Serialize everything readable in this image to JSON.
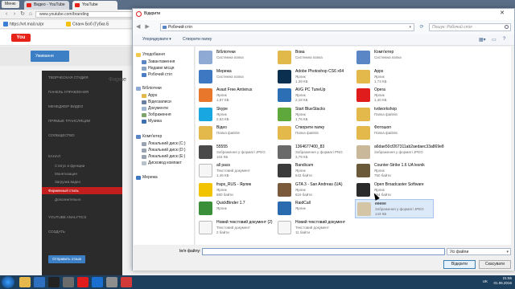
{
  "browser": {
    "menu_label": "Меню",
    "tabs": [
      {
        "label": "Видео - YouTube",
        "color": "#e62117"
      },
      {
        "label": "YouTube",
        "color": "#e62117"
      }
    ],
    "url": "www.youtube.com/branding",
    "bookmarks": [
      {
        "label": "https://vrl.mail.ru/pr",
        "color": "#3a7fd5"
      },
      {
        "label": "Спанч Боб (Губка Б",
        "color": "#f4c20d"
      }
    ]
  },
  "youtube": {
    "logo": "You",
    "subscribe_label": "Уживання",
    "studio_items": [
      "ТВОРЧЕСКАЯ СТУДИЯ",
      "ПАНЕЛЬ УПРАВЛЕНИЯ",
      "МЕНЕДЖЕР ВИДЕО",
      "ПРЯМЫЕ ТРАНСЛЯЦИИ",
      "СООБЩЕСТВО",
      "КАНАЛ",
      "Статус и функции",
      "Монетизация",
      "Загрузка видео",
      "Фирменный стиль",
      "Дополнительно",
      "YOUTUBE ANALYTICS",
      "СОЗДАТЬ"
    ],
    "active_item": "Фирменный стиль",
    "right_heading": "Фирме",
    "save_label": "Отправить отзыв"
  },
  "dialog": {
    "title": "Відкрити",
    "path": "Робочий стіл",
    "search_placeholder": "Пошук: Робочий стіл",
    "toolbar": {
      "organize": "Упорядкувати ▾",
      "new_folder": "Створити папку"
    },
    "nav": {
      "favorites_header": "Уподобання",
      "favorites": [
        "Завантаження",
        "Недавні місця",
        "Робочий стіл"
      ],
      "libraries_header": "Бібліотеки",
      "libraries": [
        "Apps",
        "Відеозаписи",
        "Документи",
        "Зображення",
        "Музика"
      ],
      "computer_header": "Комп'ютер",
      "drives": [
        "Локальний диск (C:)",
        "Локальний диск (D:)",
        "Локальний диск (E:)",
        "Дисковод компакт"
      ],
      "network": "Мережа"
    },
    "files": [
      {
        "name": "Бібліотеки",
        "type": "Системна папка",
        "size": "",
        "icon": "libraries-icon",
        "color": "#8da9d4"
      },
      {
        "name": "Вова",
        "type": "Системна папка",
        "size": "",
        "icon": "user-folder-icon",
        "color": "#e0b94a"
      },
      {
        "name": "Комп'ютер",
        "type": "Системна папка",
        "size": "",
        "icon": "computer-icon",
        "color": "#5b86c5"
      },
      {
        "name": "",
        "type": "",
        "size": "",
        "icon": "blank-icon",
        "color": "#ffffff"
      },
      {
        "name": "Мережа",
        "type": "Системна папка",
        "size": "",
        "icon": "network-icon",
        "color": "#3f78c2"
      },
      {
        "name": "Adobe Photoshop CS6 x64",
        "type": "Ярлик",
        "size": "1,39 КБ",
        "icon": "photoshop-icon",
        "color": "#0b2f4e"
      },
      {
        "name": "Apps",
        "type": "Ярлик",
        "size": "1,73 КБ",
        "icon": "apps-folder-icon",
        "color": "#e3b94c"
      },
      {
        "name": "",
        "type": "",
        "size": "",
        "icon": "blank-icon",
        "color": "#ffffff"
      },
      {
        "name": "Avast Free Antivirus",
        "type": "Ярлик",
        "size": "1,87 КБ",
        "icon": "avast-icon",
        "color": "#e8762b"
      },
      {
        "name": "AVG PC TuneUp",
        "type": "Ярлик",
        "size": "2,18 КБ",
        "icon": "tuneup-icon",
        "color": "#2c6fb5"
      },
      {
        "name": "Opera",
        "type": "Ярлик",
        "size": "1,40 КБ",
        "icon": "opera-icon",
        "color": "#e01c1c"
      },
      {
        "name": "",
        "type": "",
        "size": "",
        "icon": "blank-icon",
        "color": "#ffffff"
      },
      {
        "name": "Skype",
        "type": "Ярлик",
        "size": "2,63 КБ",
        "icon": "skype-icon",
        "color": "#18a7e0"
      },
      {
        "name": "Start BlueStacks",
        "type": "Ярлик",
        "size": "1,76 КБ",
        "icon": "bluestacks-icon",
        "color": "#5fa83b"
      },
      {
        "name": "tvdworkshop",
        "type": "Папка файлів",
        "size": "",
        "icon": "folder-icon",
        "color": "#e3b94c"
      },
      {
        "name": "",
        "type": "",
        "size": "",
        "icon": "blank-icon",
        "color": "#ffffff"
      },
      {
        "name": "Відео",
        "type": "Папка файлів",
        "size": "",
        "icon": "video-folder-icon",
        "color": "#e3b94c"
      },
      {
        "name": "Створити папку",
        "type": "Папка файлів",
        "size": "",
        "icon": "folder-icon",
        "color": "#e3b94c"
      },
      {
        "name": "Фотошоп",
        "type": "Папка файлів",
        "size": "",
        "icon": "folder-icon",
        "color": "#e3b94c"
      },
      {
        "name": "",
        "type": "",
        "size": "",
        "icon": "blank-icon",
        "color": "#ffffff"
      },
      {
        "name": "55555",
        "type": "Зображення у форматі JPEG",
        "size": "104 КБ",
        "icon": "image-thumb-icon",
        "color": "#4a4a4a"
      },
      {
        "name": "1364677400_83",
        "type": "Зображення у форматі PNG",
        "size": "3,79 КБ",
        "icon": "image-thumb-icon",
        "color": "#6a6a6a"
      },
      {
        "name": "a6dae50cf267311ab2aedaec33a869e8",
        "type": "Зображення у форматі JPEG",
        "size": "",
        "icon": "image-thumb-icon",
        "color": "#c9b89a"
      },
      {
        "name": "",
        "type": "",
        "size": "",
        "icon": "blank-icon",
        "color": "#ffffff"
      },
      {
        "name": "all pass",
        "type": "Текстовий документ",
        "size": "1,46 КБ",
        "icon": "text-doc-icon",
        "color": "#f6f6f6"
      },
      {
        "name": "Bandicam",
        "type": "Ярлик",
        "size": "642 байти",
        "icon": "bandicam-icon",
        "color": "#3b3b3b"
      },
      {
        "name": "Counter-Strike 1.6 UA lesnik",
        "type": "Ярлик",
        "size": "750 байти",
        "icon": "cs-icon",
        "color": "#6b5a3a"
      },
      {
        "name": "",
        "type": "",
        "size": "",
        "icon": "blank-icon",
        "color": "#ffffff"
      },
      {
        "name": "fraps_RUS - Ярлик",
        "type": "Ярлик",
        "size": "680 байти",
        "icon": "fraps-icon",
        "color": "#f2c300"
      },
      {
        "name": "GTA 3 - San Andreas (UA)",
        "type": "Ярлик",
        "size": "616 байти",
        "icon": "gta-icon",
        "color": "#7a5a3a"
      },
      {
        "name": "Open Broadcaster Software",
        "type": "Ярлик",
        "size": "664 байти",
        "icon": "obs-icon",
        "color": "#2b2b2b"
      },
      {
        "name": "",
        "type": "",
        "size": "",
        "icon": "blank-icon",
        "color": "#ffffff"
      },
      {
        "name": "QuickBinder 1.7",
        "type": "Ярлик",
        "size": "",
        "icon": "quickbinder-icon",
        "color": "#3a8f3a"
      },
      {
        "name": "RaidCall",
        "type": "Ярлик",
        "size": "",
        "icon": "raidcall-icon",
        "color": "#2a6bb0"
      },
      {
        "name": "eeeee",
        "type": "Зображення у форматі JPEG",
        "size": "143 КБ",
        "icon": "image-thumb-icon",
        "color": "#d3c5a6"
      },
      {
        "name": "",
        "type": "",
        "size": "",
        "icon": "blank-icon",
        "color": "#ffffff"
      },
      {
        "name": "Новий текстовий документ (2)",
        "type": "Текстовий документ",
        "size": "2 байти",
        "icon": "text-doc-icon",
        "color": "#f6f6f6"
      },
      {
        "name": "Новий текстовий документ",
        "type": "Текстовий документ",
        "size": "11 байти",
        "icon": "text-doc-icon",
        "color": "#f6f6f6"
      }
    ],
    "selected_file": "eeeee",
    "filename_label": "Ім'я файлу:",
    "filename_value": "",
    "filter_label": "Усі файли",
    "open_label": "Відкрити",
    "cancel_label": "Скасувати"
  },
  "taskbar": {
    "language": "UK",
    "time": "21:55",
    "date": "01.06.2016",
    "apps": [
      {
        "name": "explorer-icon",
        "color": "#e6b74a"
      },
      {
        "name": "media-player-icon",
        "color": "#2f6fbf"
      },
      {
        "name": "terminal-icon",
        "color": "#222222"
      },
      {
        "name": "game-icon",
        "color": "#6b6b6b"
      },
      {
        "name": "opera-icon",
        "color": "#e01c1c"
      },
      {
        "name": "mail-icon",
        "color": "#1b6fd1"
      },
      {
        "name": "paint-icon",
        "color": "#8e8e8e"
      },
      {
        "name": "recorder-icon",
        "color": "#d23a3a"
      }
    ]
  }
}
